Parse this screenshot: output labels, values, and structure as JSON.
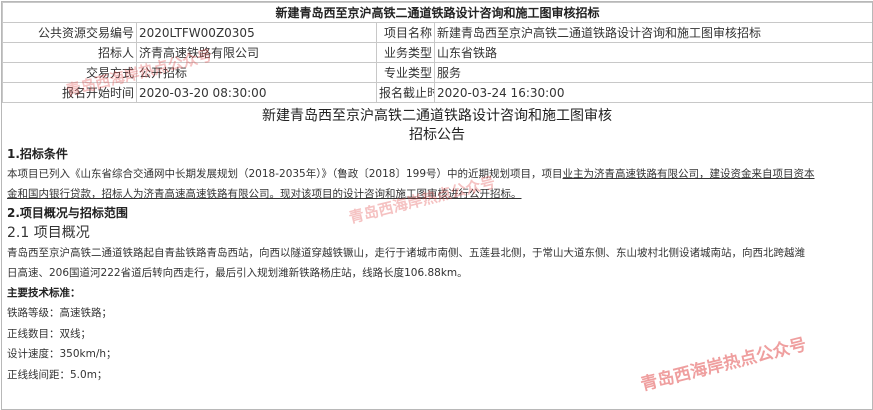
{
  "header": {
    "title": "新建青岛西至京沪高铁二通道铁路设计咨询和施工图审核招标"
  },
  "info_rows": [
    {
      "label1": "公共资源交易编号",
      "value1": "2020LTFW00Z0305",
      "label2": "项目名称",
      "value2": "新建青岛西至京沪高铁二通道铁路设计咨询和施工图审核招标"
    },
    {
      "label1": "招标人",
      "value1": "济青高速铁路有限公司",
      "label2": "业务类型",
      "value2": "山东省铁路"
    },
    {
      "label1": "交易方式",
      "value1": "公开招标",
      "label2": "专业类型",
      "value2": "服务"
    },
    {
      "label1": "报名开始时间",
      "value1": "2020-03-20 08:30:00",
      "label2": "报名截止时间",
      "value2": "2020-03-24 16:30:00"
    }
  ],
  "announcement": {
    "title": "新建青岛西至京沪高铁二通道铁路设计咨询和施工图审核",
    "subtitle": "招标公告",
    "sec1_heading": "1.招标条件",
    "sec1_line1_plain": "本项目已列入《山东省综合交通网中长期发展规划（2018-2035年）》（鲁政〔2018〕199号）中的近期规划项目，项目",
    "sec1_line1_underline": "业主为济青高速铁路有限公司，建设资金来自项目资本",
    "sec1_line2": "金和国内银行贷款，招标人为济青高速高速铁路有限公司。现对该项目的设计咨询和施工图审核进行公开招标。",
    "sec2_heading": "2.项目概况与招标范围",
    "sec2_1_heading": "2.1 项目概况",
    "sec2_para_line1": "青岛西至京沪高铁二通道铁路起自青盐铁路青岛西站，向西以隧道穿越铁镢山，走行于诸城市南侧、五莲县北侧，于常山大道东侧、东山坡村北侧设诸城南站，向西北跨越潍",
    "sec2_para_line2": "日高速、206国道河222省道后转向西走行，最后引入规划潍新铁路杨庄站，线路长度106.88km。",
    "tech_heading": "主要技术标准：",
    "tech_items": [
      "铁路等级：高速铁路；",
      "正线数目：双线；",
      "设计速度：350km/h；",
      "正线线间距：5.0m；"
    ]
  },
  "watermarks": {
    "wm1": "青岛西海岸热点公众号",
    "wm2": "青岛西海岸热点公众号",
    "wm3": "青岛西海岸热点公众号"
  }
}
